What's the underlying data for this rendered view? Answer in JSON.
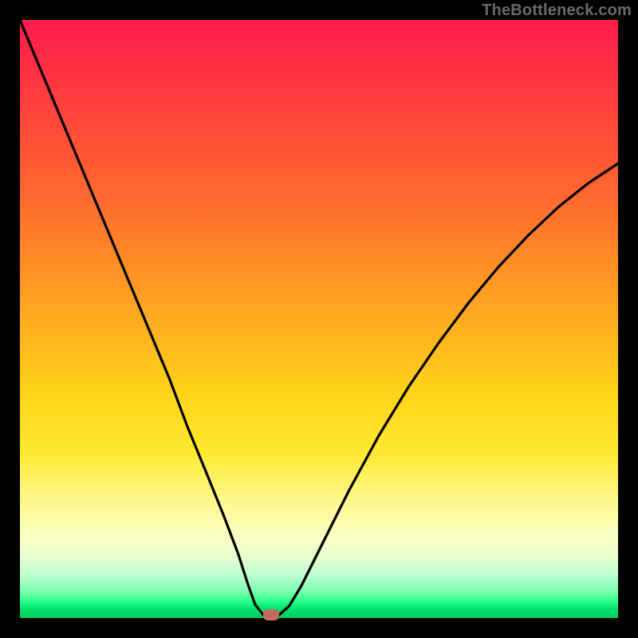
{
  "watermark": {
    "text": "TheBottleneck.com"
  },
  "chart_data": {
    "type": "line",
    "title": "",
    "xlabel": "",
    "ylabel": "",
    "xlim": [
      0,
      100
    ],
    "ylim": [
      0,
      100
    ],
    "grid": false,
    "background_gradient": {
      "direction": "top-to-bottom",
      "stops": [
        {
          "pos": 0.0,
          "color": "#ff1a4d"
        },
        {
          "pos": 0.3,
          "color": "#ff6a2f"
        },
        {
          "pos": 0.62,
          "color": "#ffd21a"
        },
        {
          "pos": 0.86,
          "color": "#fbffc0"
        },
        {
          "pos": 0.97,
          "color": "#2cff8a"
        },
        {
          "pos": 1.0,
          "color": "#00c85f"
        }
      ]
    },
    "series": [
      {
        "name": "bottleneck-curve",
        "color": "#000000",
        "x": [
          0,
          5,
          10,
          15,
          20,
          25,
          28,
          31,
          34,
          36.5,
          38,
          39.3,
          40.7,
          43.3,
          45,
          47,
          50,
          55,
          60,
          65,
          70,
          75,
          80,
          85,
          90,
          95,
          100
        ],
        "y": [
          100,
          88,
          76,
          64,
          52,
          40,
          32,
          24.7,
          17.3,
          10.7,
          6,
          2.3,
          0.5,
          0.5,
          2,
          5.3,
          11.3,
          21.3,
          30.5,
          38.7,
          46,
          52.7,
          58.7,
          64,
          68.7,
          72.7,
          76
        ]
      }
    ],
    "annotations": [
      {
        "name": "marker",
        "x": 42,
        "y": 0.5,
        "shape": "pill",
        "color": "#c96a60"
      }
    ]
  }
}
